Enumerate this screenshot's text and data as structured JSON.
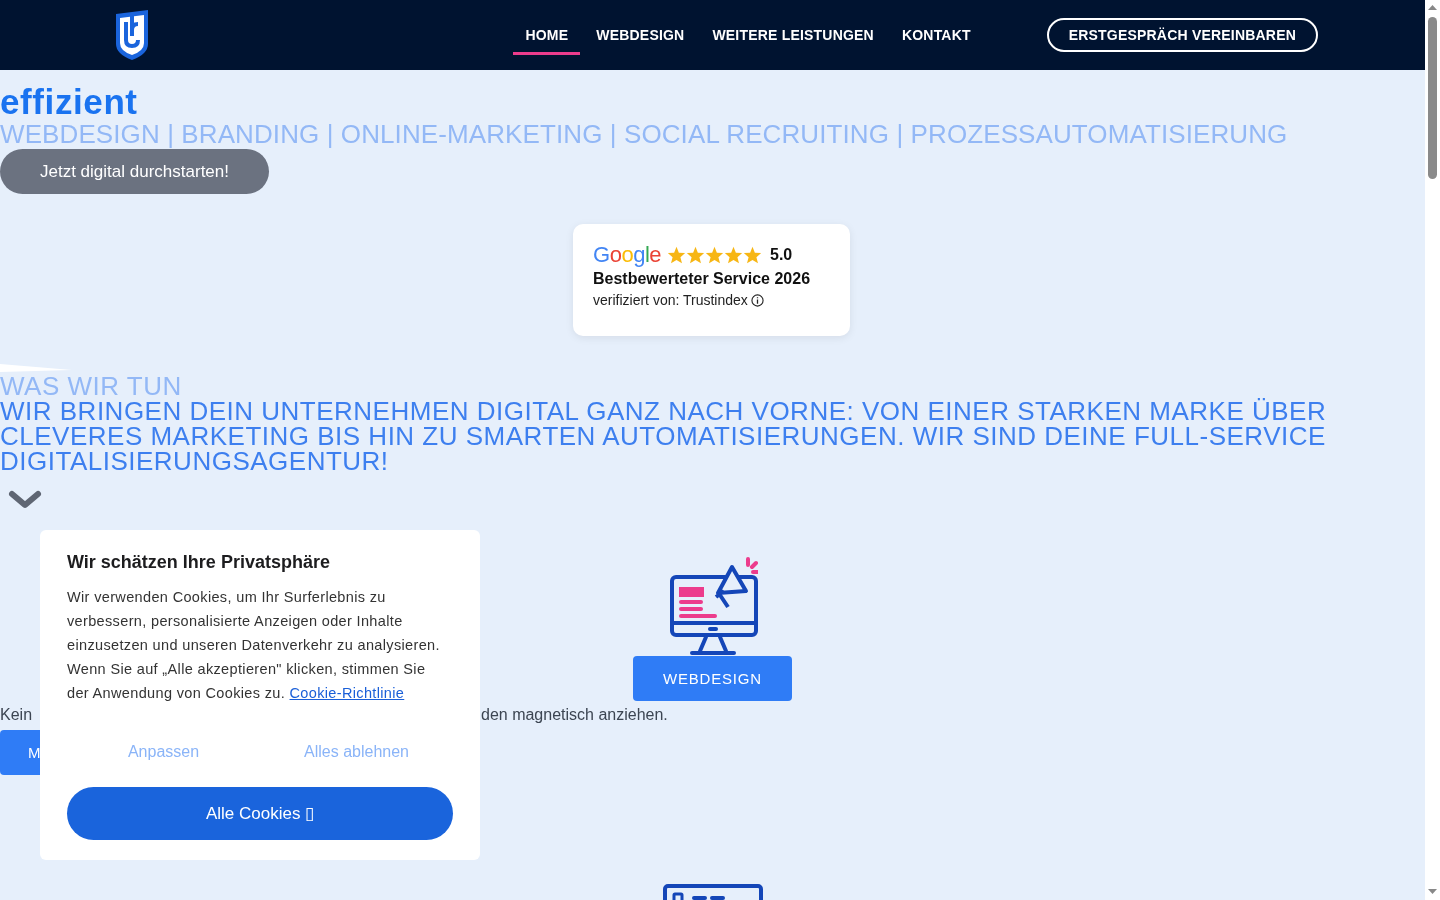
{
  "header": {
    "nav": [
      {
        "label": "HOME",
        "selected": true
      },
      {
        "label": "WEBDESIGN",
        "selected": false
      },
      {
        "label": "WEITERE LEISTUNGEN",
        "selected": false
      },
      {
        "label": "KONTAKT",
        "selected": false
      }
    ],
    "cta": "ERSTGESPRÄCH VEREINBAREN"
  },
  "hero": {
    "title": "effizient",
    "subtitle": "WEBDESIGN | BRANDING | ONLINE-MARKETING | SOCIAL RECRUITING | PROZESSAUTOMATISIERUNG",
    "button": "Jetzt digital durchstarten!"
  },
  "review_badge": {
    "brand": "Google",
    "stars": 5,
    "score": "5.0",
    "title": "Bestbewerteter Service 2026",
    "verified": "verifiziert von: Trustindex"
  },
  "about": {
    "eyebrow": "WAS WIR TUN",
    "text": "WIR BRINGEN DEIN UNTERNEHMEN DIGITAL GANZ NACH VORNE: VON EINER STARKEN MARKE ÜBER CLEVERES MARKETING BIS HIN ZU SMARTEN AUTOMATISIERUNGEN. WIR SIND DEINE FULL-SERVICE DIGITALISIERUNGSAGENTUR!"
  },
  "services": [
    {
      "kind": "monitor",
      "label": "WEBDESIGN"
    },
    {
      "kind": "browser"
    }
  ],
  "behind_dialog": {
    "text_start": "Kein",
    "text_end": "den magnetisch anziehen.",
    "button_start": "M"
  },
  "cookie_dialog": {
    "title": "Wir schätzen Ihre Privatsphäre",
    "body": "Wir verwenden Cookies, um Ihr Surferlebnis zu verbessern, personalisierte Anzeigen oder Inhalte einzusetzen und unseren Datenverkehr zu analysieren. Wenn Sie auf „Alle akzeptieren\" klicken, stimmen Sie der Anwendung von Cookies zu.",
    "link": "Cookie-Richtlinie",
    "customize": "Anpassen",
    "reject": "Alles ablehnen",
    "accept": "Alle Cookies ▯"
  }
}
